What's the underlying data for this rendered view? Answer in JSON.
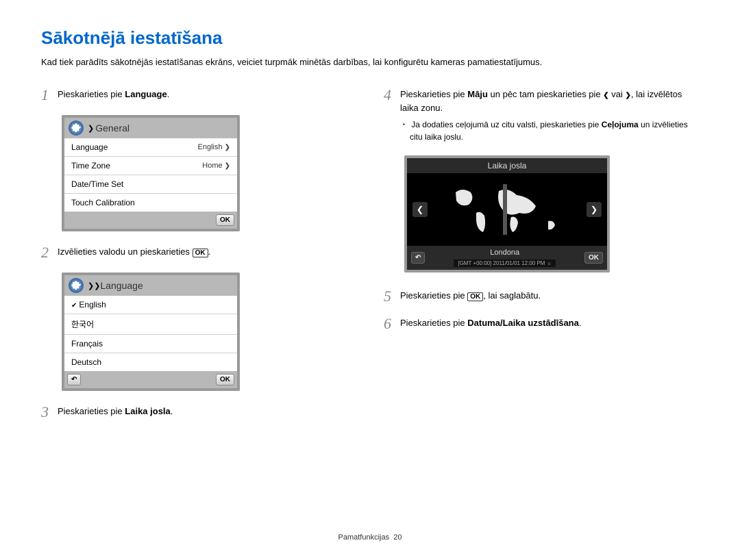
{
  "title": "Sākotnējā iestatīšana",
  "intro": "Kad tiek parādīts sākotnējās iestatīšanas ekrāns, veiciet turpmāk minētās darbības, lai konfigurētu kameras pamatiestatījumus.",
  "steps": {
    "s1": {
      "pre": "Pieskarieties pie ",
      "b": "Language",
      "post": "."
    },
    "s2": {
      "text_pre": "Izvēlieties valodu un pieskarieties ",
      "text_post": "."
    },
    "s3": {
      "pre": "Pieskarieties pie ",
      "b": "Laika josla",
      "post": "."
    },
    "s4": {
      "pre": "Pieskarieties pie ",
      "b": "Māju",
      "mid": " un pēc tam pieskarieties pie ",
      "tail": ", lai izvēlētos laika zonu.",
      "or": " vai "
    },
    "s4_note": {
      "pre": "Ja dodaties ceļojumā uz citu valsti, pieskarieties pie ",
      "b": "Ceļojuma",
      "post": " un izvēlieties citu laika joslu."
    },
    "s5": {
      "pre": "Pieskarieties pie ",
      "post": ", lai saglabātu."
    },
    "s6": {
      "pre": "Pieskarieties pie ",
      "b": "Datuma/Laika uzstādīšana",
      "post": "."
    }
  },
  "scr_general": {
    "title": "General",
    "rows": [
      {
        "label": "Language",
        "value": "English"
      },
      {
        "label": "Time Zone",
        "value": "Home"
      },
      {
        "label": "Date/Time Set",
        "value": ""
      },
      {
        "label": "Touch Calibration",
        "value": ""
      }
    ],
    "ok": "OK"
  },
  "scr_language": {
    "title": "Language",
    "items": [
      "English",
      "한국어",
      "Français",
      "Deutsch"
    ],
    "ok": "OK"
  },
  "scr_tz": {
    "title": "Laika josla",
    "city": "Londona",
    "gmt": "[GMT +00:00] 2011/01/01 12:00 PM ☼",
    "ok": "OK"
  },
  "ok_label": "OK",
  "footer": {
    "label": "Pamatfunkcijas",
    "page": "20"
  }
}
